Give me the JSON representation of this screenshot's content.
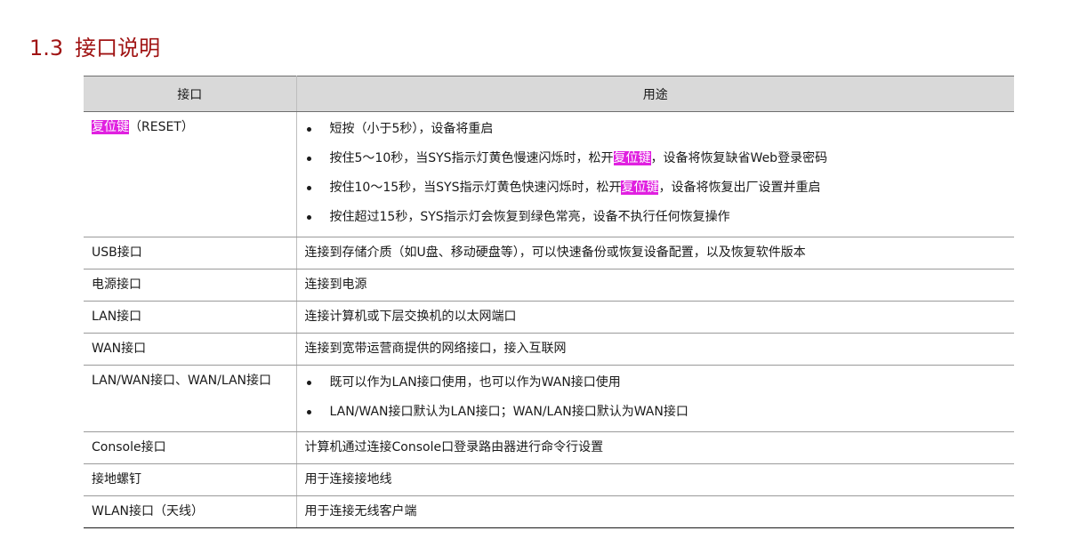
{
  "section": {
    "number": "1.3",
    "title": "接口说明"
  },
  "table": {
    "headers": [
      "接口",
      "用途"
    ],
    "reset_row": {
      "name_highlight": "复位键",
      "name_suffix": "（RESET）",
      "bullets": [
        {
          "parts": [
            "短按（小于5秒），设备将重启"
          ]
        },
        {
          "parts": [
            "按住5～10秒，当SYS指示灯黄色慢速闪烁时，松开",
            "复位键",
            "，设备将恢复缺省Web登录密码"
          ]
        },
        {
          "parts": [
            "按住10～15秒，当SYS指示灯黄色快速闪烁时，松开",
            "复位键",
            "，设备将恢复出厂设置并重启"
          ]
        },
        {
          "parts": [
            "按住超过15秒，SYS指示灯会恢复到绿色常亮，设备不执行任何恢复操作"
          ]
        }
      ]
    },
    "rows": [
      {
        "name": "USB接口",
        "desc": "连接到存储介质（如U盘、移动硬盘等），可以快速备份或恢复设备配置，以及恢复软件版本"
      },
      {
        "name": "电源接口",
        "desc": "连接到电源"
      },
      {
        "name": "LAN接口",
        "desc": "连接计算机或下层交换机的以太网端口"
      },
      {
        "name": "WAN接口",
        "desc": "连接到宽带运营商提供的网络接口，接入互联网"
      }
    ],
    "lanwan_row": {
      "name": "LAN/WAN接口、WAN/LAN接口",
      "bullets": [
        "既可以作为LAN接口使用，也可以作为WAN接口使用",
        "LAN/WAN接口默认为LAN接口；WAN/LAN接口默认为WAN接口"
      ]
    },
    "rows_after": [
      {
        "name": "Console接口",
        "desc": "计算机通过连接Console口登录路由器进行命令行设置"
      },
      {
        "name": "接地螺钉",
        "desc": "用于连接接地线"
      },
      {
        "name": "WLAN接口（天线）",
        "desc": "用于连接无线客户端"
      }
    ]
  },
  "colors": {
    "title": "#a01414",
    "highlight": "#e020e0",
    "header_bg": "#d9d9d9"
  }
}
